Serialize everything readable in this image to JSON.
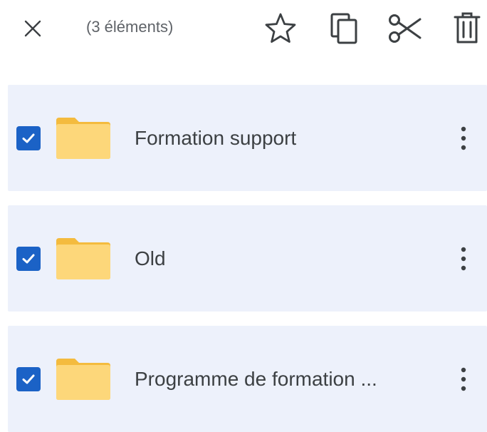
{
  "selection": {
    "count_label": "(3 éléments)"
  },
  "toolbar": {
    "icons": [
      "close-icon",
      "star-icon",
      "copy-icon",
      "scissors-icon",
      "trash-icon"
    ]
  },
  "colors": {
    "row_background": "#edf1fb",
    "checkbox": "#1b62c6",
    "folder": "#fdd77a",
    "text": "#3c4043",
    "icon": "#3c4043"
  },
  "files": [
    {
      "name": "Formation support",
      "type": "folder",
      "selected": true
    },
    {
      "name": "Old",
      "type": "folder",
      "selected": true
    },
    {
      "name": "Programme de formation ...",
      "type": "folder",
      "selected": true
    }
  ]
}
